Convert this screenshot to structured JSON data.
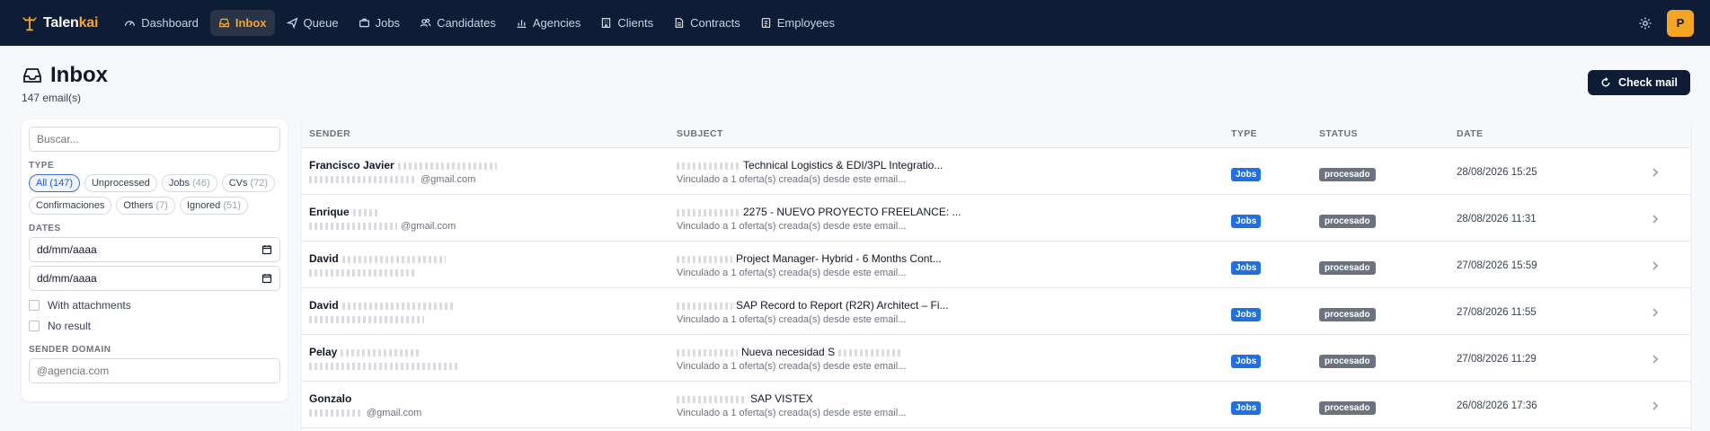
{
  "brand": {
    "name_main": "Talen",
    "name_accent": "kai"
  },
  "nav": [
    {
      "label": "Dashboard",
      "icon": "gauge-icon",
      "active": false
    },
    {
      "label": "Inbox",
      "icon": "inbox-icon",
      "active": true
    },
    {
      "label": "Queue",
      "icon": "send-icon",
      "active": false
    },
    {
      "label": "Jobs",
      "icon": "briefcase-icon",
      "active": false
    },
    {
      "label": "Candidates",
      "icon": "users-icon",
      "active": false
    },
    {
      "label": "Agencies",
      "icon": "chart-icon",
      "active": false
    },
    {
      "label": "Clients",
      "icon": "building-icon",
      "active": false
    },
    {
      "label": "Contracts",
      "icon": "document-icon",
      "active": false
    },
    {
      "label": "Employees",
      "icon": "id-card-icon",
      "active": false
    }
  ],
  "user": {
    "initial": "P"
  },
  "page": {
    "title": "Inbox",
    "count": "147 email(s)",
    "check_label": "Check mail"
  },
  "filters": {
    "search_placeholder": "Buscar...",
    "type_label": "TYPE",
    "types": [
      {
        "label": "All",
        "count": "(147)",
        "active": true
      },
      {
        "label": "Unprocessed",
        "count": "",
        "active": false
      },
      {
        "label": "Jobs",
        "count": "(46)",
        "active": false
      },
      {
        "label": "CVs",
        "count": "(72)",
        "active": false
      },
      {
        "label": "Confirmaciones",
        "count": "",
        "active": false
      },
      {
        "label": "Others",
        "count": "(7)",
        "active": false
      },
      {
        "label": "Ignored",
        "count": "(51)",
        "active": false
      }
    ],
    "dates_label": "DATES",
    "date_from": "dd/mm/aaaa",
    "date_to": "dd/mm/aaaa",
    "with_attachments": "With attachments",
    "no_result": "No result",
    "domain_label": "SENDER DOMAIN",
    "domain_placeholder": "@agencia.com"
  },
  "table": {
    "headers": {
      "sender": "SENDER",
      "subject": "SUBJECT",
      "type": "TYPE",
      "status": "STATUS",
      "date": "DATE"
    },
    "rows": [
      {
        "sender": "Francisco Javier",
        "sender_email": "@gmail.com",
        "subject": "Technical Logistics & EDI/3PL Integratio...",
        "subject_sub": "Vinculado a 1 oferta(s) creada(s) desde este email...",
        "type": "Jobs",
        "status": "procesado",
        "date": "28/08/2026 15:25"
      },
      {
        "sender": "Enrique",
        "sender_email": "@gmail.com",
        "subject": "2275 - NUEVO PROYECTO FREELANCE: ...",
        "subject_sub": "Vinculado a 1 oferta(s) creada(s) desde este email...",
        "type": "Jobs",
        "status": "procesado",
        "date": "28/08/2026 11:31"
      },
      {
        "sender": "David",
        "sender_email": "",
        "subject": "Project Manager- Hybrid - 6 Months Cont...",
        "subject_sub": "Vinculado a 1 oferta(s) creada(s) desde este email...",
        "type": "Jobs",
        "status": "procesado",
        "date": "27/08/2026 15:59"
      },
      {
        "sender": "David",
        "sender_email": "",
        "subject": "SAP Record to Report (R2R) Architect – Fi...",
        "subject_sub": "Vinculado a 1 oferta(s) creada(s) desde este email...",
        "type": "Jobs",
        "status": "procesado",
        "date": "27/08/2026 11:55"
      },
      {
        "sender": "Pelay",
        "sender_email": "",
        "subject": "Nueva necesidad S",
        "subject_sub": "Vinculado a 1 oferta(s) creada(s) desde este email...",
        "type": "Jobs",
        "status": "procesado",
        "date": "27/08/2026 11:29"
      },
      {
        "sender": "Gonzalo",
        "sender_email": "@gmail.com",
        "subject": "SAP VISTEX",
        "subject_sub": "Vinculado a 1 oferta(s) creada(s) desde este email...",
        "type": "Jobs",
        "status": "procesado",
        "date": "26/08/2026 17:36"
      }
    ]
  }
}
